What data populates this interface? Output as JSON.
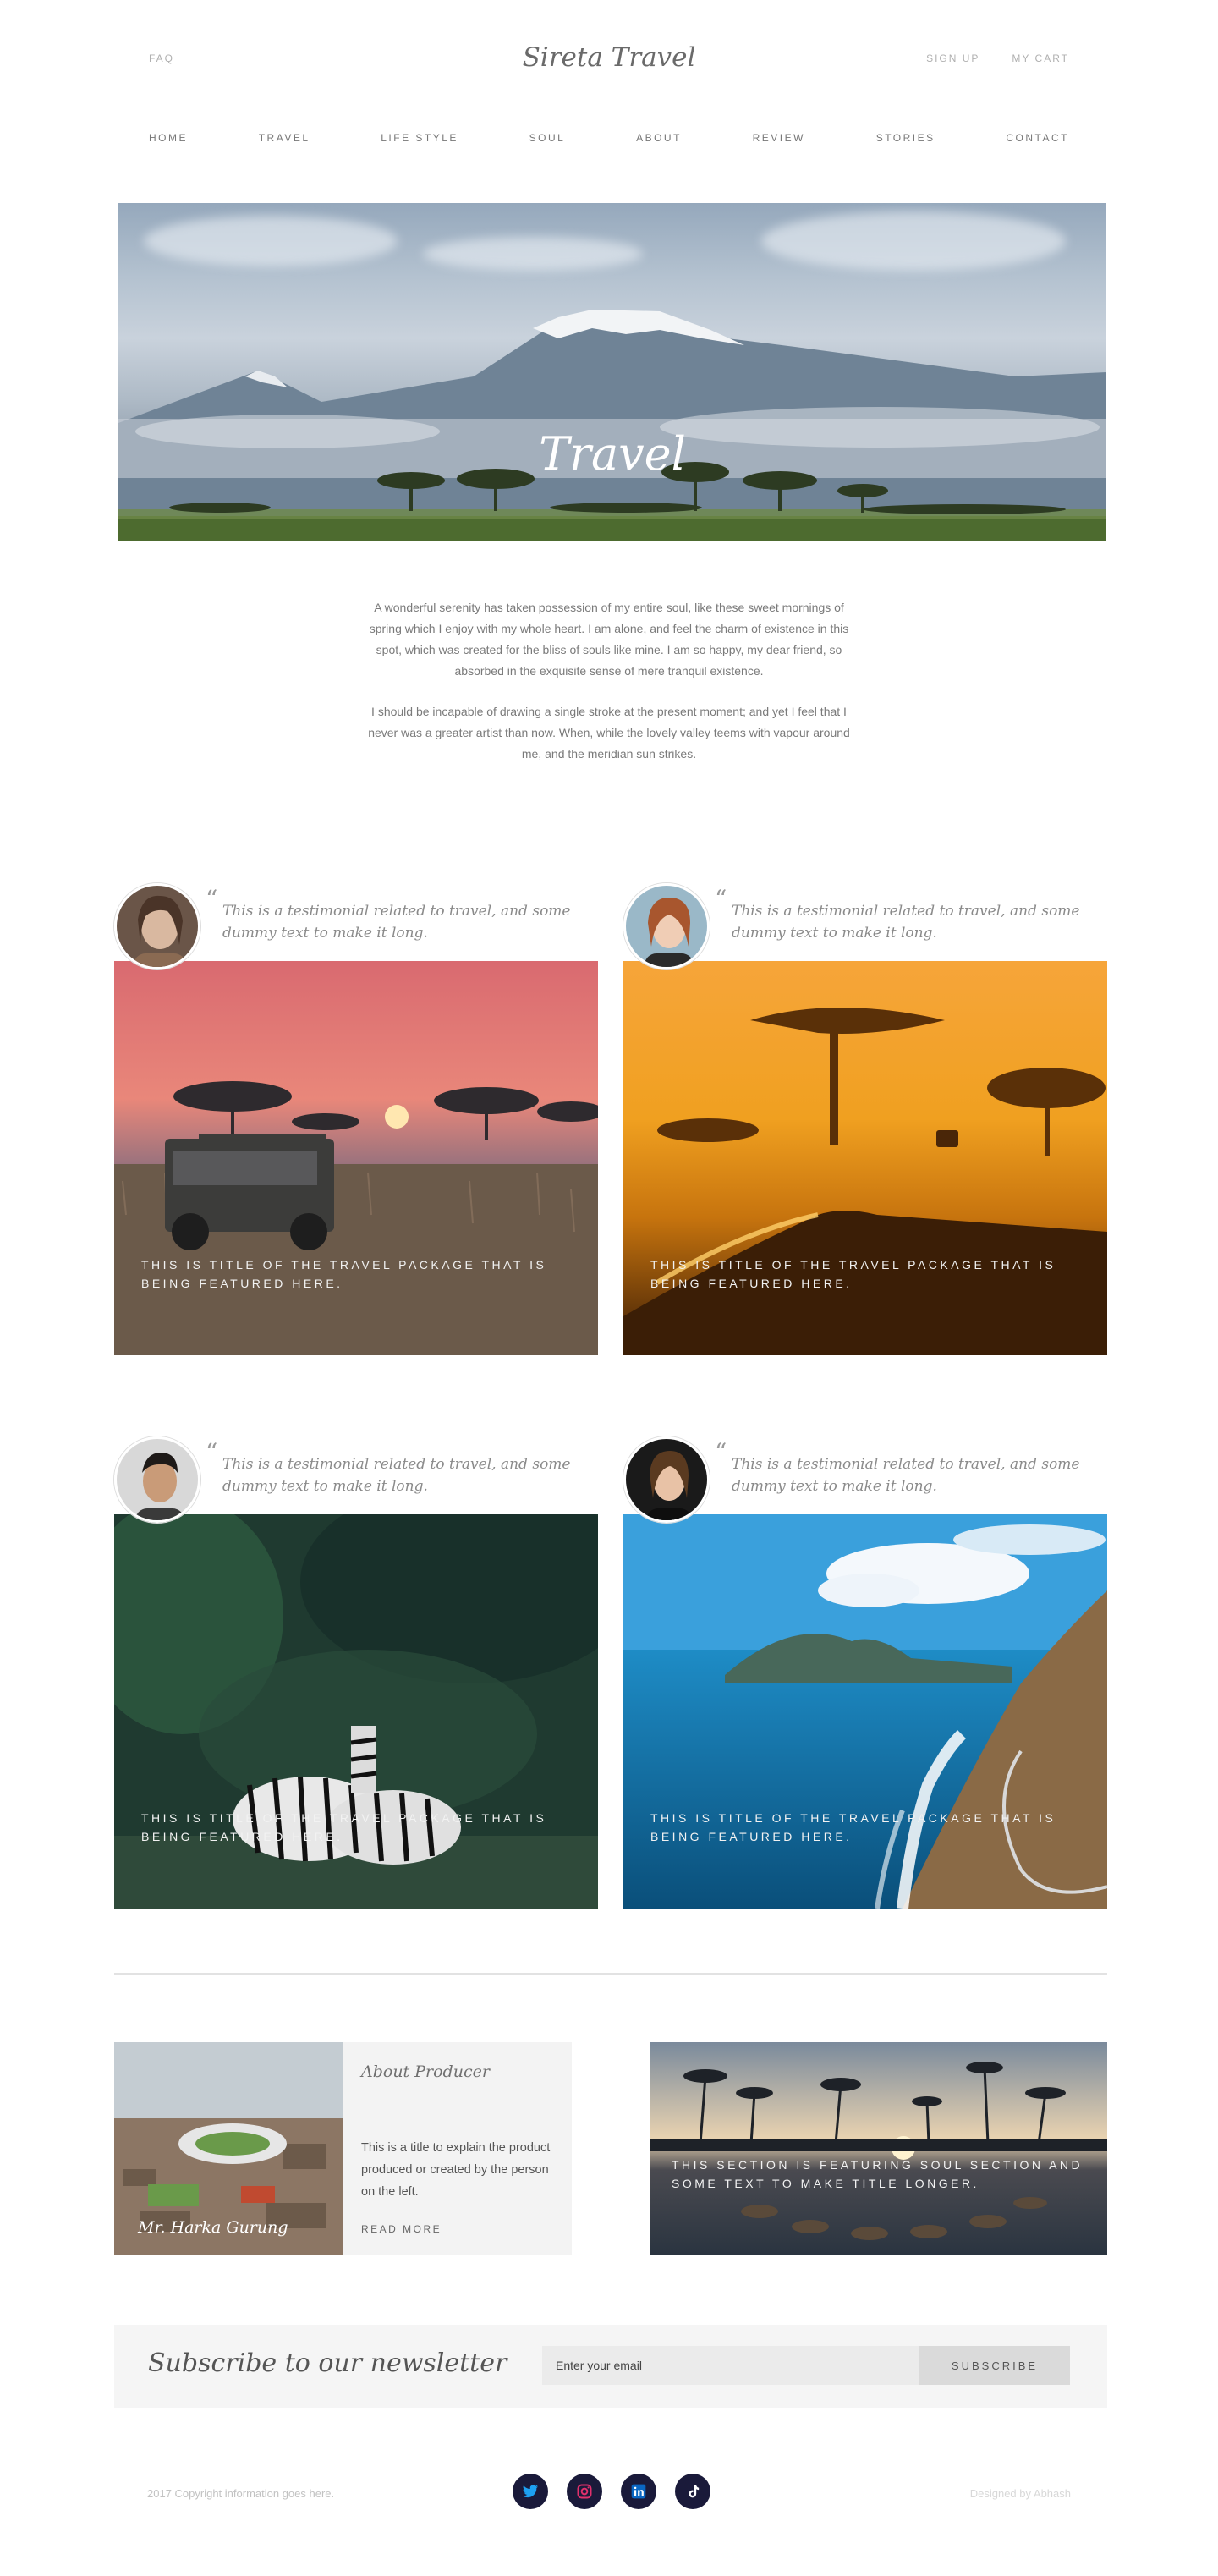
{
  "header": {
    "faq": "FAQ",
    "brand": "Sireta Travel",
    "sign_up": "SIGN UP",
    "cart": "MY CART"
  },
  "nav": [
    "HOME",
    "TRAVEL",
    "LIFE STYLE",
    "SOUL",
    "ABOUT",
    "REVIEW",
    "STORIES",
    "CONTACT"
  ],
  "hero": {
    "title": "Travel"
  },
  "intro": {
    "p1": "A wonderful serenity has taken possession of my entire soul, like these sweet mornings of spring which I enjoy with my whole heart. I am alone, and feel the charm of existence in this spot, which was created for the bliss of souls like mine. I am so happy, my dear friend, so absorbed in the exquisite sense of mere tranquil existence.",
    "p2": "I should be incapable of drawing a single stroke at the present moment; and yet I feel that I never was a greater artist than now. When, while the lovely valley teems with vapour around me, and the meridian sun strikes."
  },
  "cards": [
    {
      "quote": "This is a testimonial related to travel, and some dummy text to make it long.",
      "title": "THIS IS TITLE OF THE TRAVEL PACKAGE THAT IS BEING FEATURED HERE."
    },
    {
      "quote": "This is a testimonial related to travel, and some dummy text to make it long.",
      "title": "THIS IS TITLE OF THE TRAVEL PACKAGE THAT IS BEING FEATURED HERE."
    },
    {
      "quote": "This is a testimonial related to travel, and some dummy text to make it long.",
      "title": "THIS IS TITLE OF THE TRAVEL PACKAGE THAT IS BEING FEATURED HERE."
    },
    {
      "quote": "This is a testimonial related to travel, and some dummy text to make it long.",
      "title": "THIS IS TITLE OF THE TRAVEL PACKAGE THAT IS BEING FEATURED HERE."
    }
  ],
  "producer": {
    "name": "Mr. Harka Gurung",
    "heading": "About Producer",
    "desc": "This is a title to explain the product produced or created by the person on the left.",
    "more": "READ MORE"
  },
  "soul": {
    "title": "THIS SECTION IS FEATURING SOUL SECTION AND SOME TEXT TO MAKE TITLE LONGER."
  },
  "newsletter": {
    "title": "Subscribe to our newsletter",
    "placeholder": "Enter your email",
    "button": "SUBSCRIBE"
  },
  "footer": {
    "copyright": "2017 Copyright information goes here.",
    "designed": "Designed by Abhash",
    "socials": [
      "twitter-icon",
      "instagram-icon",
      "linkedin-icon",
      "tiktok-icon"
    ]
  },
  "colors": {
    "social_bg": "#1a1a3a",
    "twitter": "#1da1f2",
    "instagram": "#e1306c",
    "linkedin": "#0a66c2",
    "tiktok": "#ffffff"
  }
}
